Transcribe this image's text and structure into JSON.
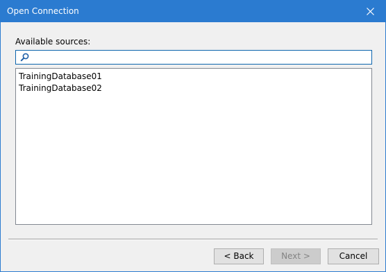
{
  "window": {
    "title": "Open Connection"
  },
  "sources": {
    "label": "Available sources:",
    "search_value": "",
    "items": [
      {
        "label": "TrainingDatabase01"
      },
      {
        "label": "TrainingDatabase02"
      }
    ]
  },
  "buttons": {
    "back": "< Back",
    "next": "Next >",
    "cancel": "Cancel"
  },
  "colors": {
    "titlebar": "#2b7bd0",
    "dialog_background": "#f0f0f0",
    "focus_border": "#0a64ad"
  },
  "icons": {
    "close": "close-icon",
    "search": "search-icon"
  }
}
